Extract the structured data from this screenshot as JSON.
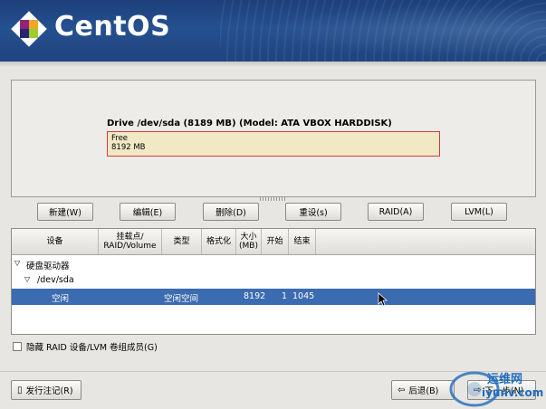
{
  "brand": {
    "name": "CentOS"
  },
  "drive": {
    "title": "Drive /dev/sda (8189 MB) (Model: ATA VBOX HARDDISK)",
    "segment_label": "Free",
    "segment_size": "8192 MB"
  },
  "toolbar": {
    "new": "新建(W)",
    "edit": "编辑(E)",
    "delete": "删除(D)",
    "reset": "重设(s)",
    "raid": "RAID(A)",
    "lvm": "LVM(L)"
  },
  "table": {
    "headers": [
      "设备",
      "挂载点/ RAID/Volume",
      "类型",
      "格式化",
      "大小 (MB)",
      "开始",
      "结束"
    ],
    "rows": [
      {
        "device": "硬盘驱动器",
        "level": 0,
        "expander": "▽"
      },
      {
        "device": "/dev/sda",
        "level": 1,
        "expander": "▽"
      },
      {
        "device": "空闲",
        "mount": "",
        "type": "空闲空间",
        "format": "",
        "size": "8192",
        "start": "1",
        "end": "1045",
        "selected": true
      }
    ]
  },
  "options": {
    "hide_raid_label": "隐藏 RAID 设备/LVM 卷组成员(G)"
  },
  "footer": {
    "release_notes": "发行注记(R)",
    "back": "后退(B)",
    "next": "下一步(N)"
  },
  "watermark": {
    "line1": "运维网",
    "line2": "iyunv.com"
  },
  "colors": {
    "header": "#25508f",
    "selection": "#3b6bb0",
    "free_fill": "#f1e8c6",
    "free_border": "#d33a3a"
  }
}
